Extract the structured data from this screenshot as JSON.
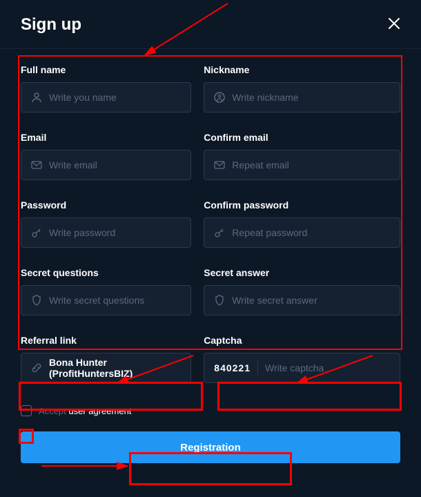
{
  "header": {
    "title": "Sign up"
  },
  "fields": {
    "fullname": {
      "label": "Full name",
      "placeholder": "Write you name"
    },
    "nickname": {
      "label": "Nickname",
      "placeholder": "Write nickname"
    },
    "email": {
      "label": "Email",
      "placeholder": "Write email"
    },
    "confemail": {
      "label": "Confirm email",
      "placeholder": "Repeat email"
    },
    "password": {
      "label": "Password",
      "placeholder": "Write password"
    },
    "confpass": {
      "label": "Confirm password",
      "placeholder": "Repeat password"
    },
    "secretq": {
      "label": "Secret questions",
      "placeholder": "Write secret questions"
    },
    "secreta": {
      "label": "Secret answer",
      "placeholder": "Write secret answer"
    }
  },
  "referral": {
    "label": "Referral link",
    "value": "Bona Hunter (ProfitHuntersBIZ)"
  },
  "captcha": {
    "label": "Captcha",
    "code": "840221",
    "placeholder": "Write captcha"
  },
  "agreement": {
    "prefix": "Accept ",
    "link": "user agreement"
  },
  "submit": {
    "label": "Registration"
  }
}
